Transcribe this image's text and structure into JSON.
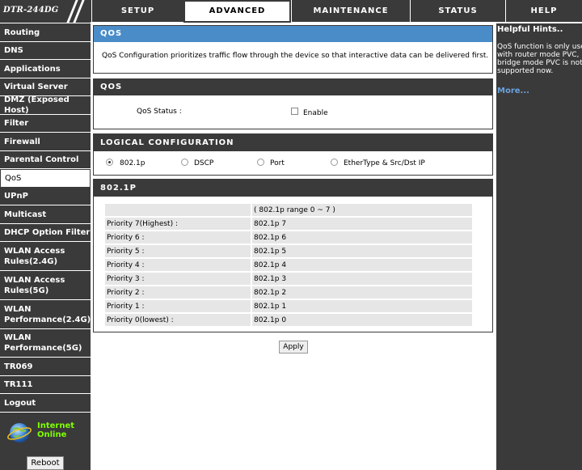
{
  "brand": {
    "logo_text": "DTR-244DG"
  },
  "tabs": [
    {
      "label": "SETUP"
    },
    {
      "label": "ADVANCED"
    },
    {
      "label": "MAINTENANCE"
    },
    {
      "label": "STATUS"
    },
    {
      "label": "HELP"
    }
  ],
  "sidebar": {
    "items": [
      {
        "label": "Routing"
      },
      {
        "label": "DNS"
      },
      {
        "label": "Applications"
      },
      {
        "label": "Virtual Server"
      },
      {
        "label": "DMZ (Exposed Host)"
      },
      {
        "label": "Filter"
      },
      {
        "label": "Firewall"
      },
      {
        "label": "Parental Control"
      },
      {
        "label": "QoS"
      },
      {
        "label": "UPnP"
      },
      {
        "label": "Multicast"
      },
      {
        "label": "DHCP Option Filter"
      },
      {
        "label": "WLAN Access Rules(2.4G)"
      },
      {
        "label": "WLAN Access Rules(5G)"
      },
      {
        "label": "WLAN Performance(2.4G)"
      },
      {
        "label": "WLAN Performance(5G)"
      },
      {
        "label": "TR069"
      },
      {
        "label": "TR111"
      },
      {
        "label": "Logout"
      }
    ],
    "status_line1": "Internet",
    "status_line2": "Online",
    "reboot_label": "Reboot"
  },
  "qos_intro": {
    "title": "QOS",
    "text": "QoS Configuration prioritizes traffic flow through the device so that interactive data can be delivered first."
  },
  "qos_status": {
    "title": "QOS",
    "label": "QoS Status :",
    "checkbox_label": "Enable",
    "enabled": false
  },
  "logical_config": {
    "title": "LOGICAL CONFIGURATION",
    "options": [
      {
        "label": "802.1p",
        "selected": true
      },
      {
        "label": "DSCP",
        "selected": false
      },
      {
        "label": "Port",
        "selected": false
      },
      {
        "label": "EtherType & Src/Dst IP",
        "selected": false
      }
    ]
  },
  "p8021": {
    "title": "802.1P",
    "range_text": "( 802.1p range 0 ~ 7 )",
    "rows": [
      {
        "label": "Priority 7(Highest) :",
        "value": "802.1p 7"
      },
      {
        "label": "Priority 6 :",
        "value": "802.1p 6"
      },
      {
        "label": "Priority 5 :",
        "value": "802.1p 5"
      },
      {
        "label": "Priority 4 :",
        "value": "802.1p 4"
      },
      {
        "label": "Priority 3 :",
        "value": "802.1p 3"
      },
      {
        "label": "Priority 2 :",
        "value": "802.1p 2"
      },
      {
        "label": "Priority 1 :",
        "value": "802.1p 1"
      },
      {
        "label": "Priority 0(lowest) :",
        "value": "802.1p 0"
      }
    ]
  },
  "apply_label": "Apply",
  "hints": {
    "title": "Helpful Hints..",
    "lines": [
      "QoS function is only used",
      "with router mode PVC,",
      "bridge mode PVC is not",
      "supported now."
    ],
    "more": "More..."
  }
}
